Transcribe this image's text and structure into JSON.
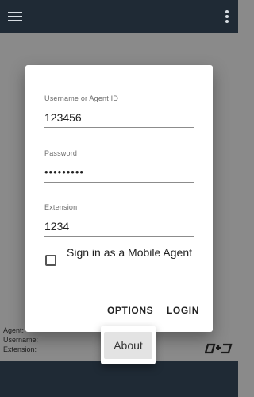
{
  "background_info": {
    "agent_label": "Agent:",
    "username_label": "Username:",
    "extension_label": "Extension:"
  },
  "login_dialog": {
    "username": {
      "label": "Username or Agent ID",
      "value": "123456"
    },
    "password": {
      "label": "Password",
      "value": "•••••••••"
    },
    "extension": {
      "label": "Extension",
      "value": "1234"
    },
    "mobile_agent": {
      "label": "Sign in as a Mobile Agent",
      "checked": false
    },
    "options_label": "OPTIONS",
    "login_label": "LOGIN"
  },
  "popup_menu": {
    "items": [
      {
        "label": "About"
      }
    ]
  },
  "colors": {
    "topbar": "#1f2a35",
    "backdrop": "#8a8a8a",
    "dialog": "#ffffff"
  },
  "icons": [
    "menu-icon",
    "more-vert-icon",
    "brand-logo"
  ]
}
